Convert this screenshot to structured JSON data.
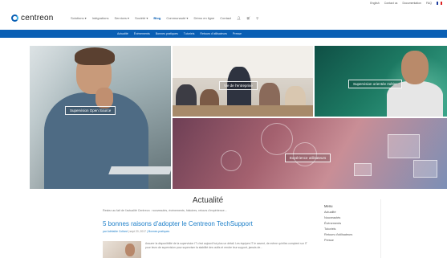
{
  "topbar": {
    "links": [
      "English",
      "Contact us",
      "Documentation",
      "FAQ"
    ],
    "language_flag": "french-flag"
  },
  "header": {
    "logo_text": "centreon",
    "nav": [
      "Solutions ▾",
      "Intégrations",
      "Services ▾",
      "Société ▾",
      "Blog",
      "Communauté ▾",
      "Démo en ligne",
      "Contact"
    ],
    "active_index": 4,
    "icons": [
      "user-icon",
      "cart-icon",
      "search-icon"
    ]
  },
  "subnav": {
    "items": [
      "Actualité",
      "Évènements",
      "Bonnes pratiques",
      "Tutoriels",
      "Retours d'utilisateurs",
      "Presse"
    ]
  },
  "hero": {
    "tile_labels": [
      "Supervision Open Source",
      "Vie de l'entreprise",
      "Supervision orientée métier",
      "Expérience utilisateurs"
    ]
  },
  "news": {
    "heading": "Actualité",
    "intro": "Restez au fait de l'actualité Centreon : nouveautés, événements, histoires, retours d'expérience...",
    "post": {
      "title": "5 bonnes raisons d'adopter le Centreon TechSupport",
      "meta_author": "par Adélaïde Collard",
      "meta_date": "| sept 20, 2017",
      "meta_category": "| Bonnes pratiques",
      "excerpt": "Assurer la disponibilité de la supervision IT c'est aujourd'hui plus un détail. Les équipes IT le savent, de même qu'elles comptent sur IT pour leurs de supervision pour superviser la stabilité des outils et rendre leur support, jamais de..."
    }
  },
  "sidebar": {
    "title": "Menu",
    "items": [
      "Actualité",
      "Nouveautés",
      "Évènements",
      "Tutoriels",
      "Retours d'utilisateurs",
      "Presse"
    ]
  },
  "colors": {
    "brand_blue": "#0a5fb4",
    "link_blue": "#1d7fc9"
  }
}
